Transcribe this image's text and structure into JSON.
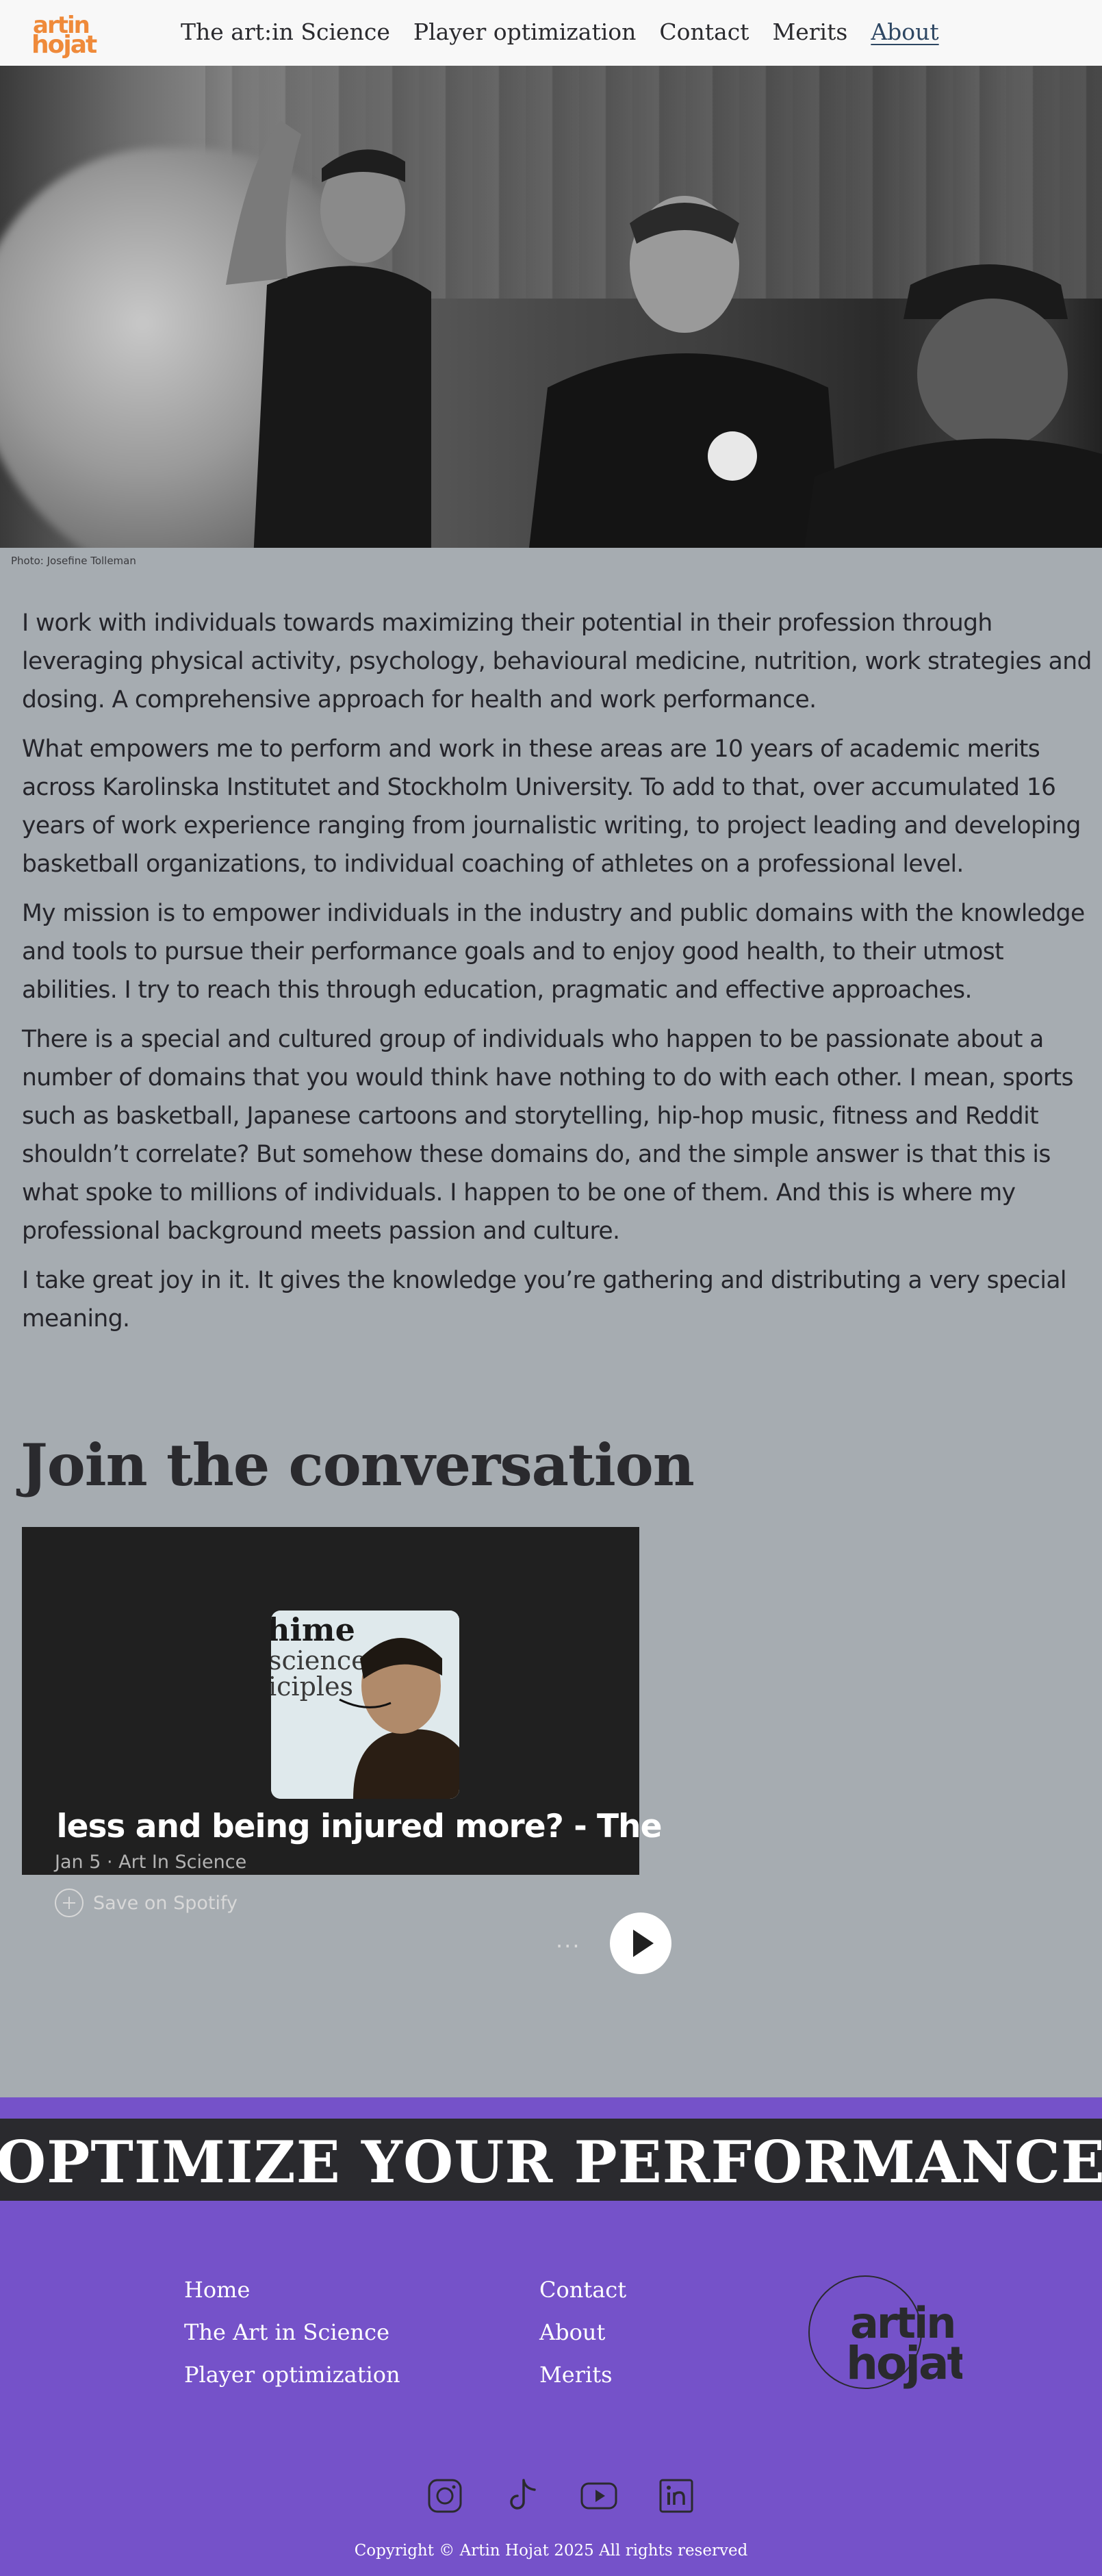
{
  "header": {
    "logo": {
      "line1": "artin",
      "line2": "hojat",
      "color": "#ef8a3a"
    },
    "nav": [
      {
        "label": "The art:in Science"
      },
      {
        "label": "Player optimization"
      },
      {
        "label": "Contact"
      },
      {
        "label": "Merits"
      },
      {
        "label": "About",
        "active": true
      }
    ]
  },
  "hero": {
    "caption": "Photo: Josefine Tolleman"
  },
  "article": {
    "paragraphs": [
      "I work with individuals towards maximizing their potential in their profession through leveraging physical activity, psychology, behavioural medicine, nutrition, work strategies and dosing. A comprehensive approach for health and work performance.",
      "What empowers me to perform and work in these areas are 10 years of academic merits across Karolinska Institutet and Stockholm University. To add to that, over accumulated 16 years of work experience ranging from journalistic writing, to project leading and developing basketball organizations, to individual coaching of athletes on a professional level.",
      "My mission is to empower individuals in the industry and public domains with the knowledge and tools to pursue their performance goals and to enjoy good health, to their utmost abilities. I try to reach this through education, pragmatic and effective approaches.",
      "There is a special and cultured group of individuals who happen to be passionate about a number of domains that you would think have nothing to do with each other. I mean, sports such as basketball, Japanese cartoons and storytelling, hip-hop music, fitness and Reddit shouldn’t correlate? But somehow these domains do, and the simple answer is that this is what spoke to millions of individuals. I happen to be one of them. And this is where my professional background meets passion and culture.",
      "I take great joy in it. It gives the knowledge you’re gathering and distributing a very special meaning."
    ]
  },
  "join": {
    "heading": "Join the conversation"
  },
  "podcast": {
    "episode_title": "ng less and being injured more? - The Bigg",
    "meta": "Jan 5 · Art In Science",
    "save_label": "Save on Spotify",
    "more_label": "···",
    "cover_text": "hime science iciples in"
  },
  "footer": {
    "marquee": "OPTIMIZE YOUR PERFORMANCE OPTIMIZE YOUR PERFORMANCE",
    "links_col1": [
      {
        "label": "Home"
      },
      {
        "label": "The Art in Science"
      },
      {
        "label": "Player optimization"
      }
    ],
    "links_col2": [
      {
        "label": "Contact"
      },
      {
        "label": "About"
      },
      {
        "label": "Merits"
      }
    ],
    "logo": {
      "line1": "artin",
      "line2": "hojat"
    },
    "social": [
      {
        "icon": "instagram-icon"
      },
      {
        "icon": "tiktok-icon"
      },
      {
        "icon": "youtube-icon"
      },
      {
        "icon": "linkedin-icon"
      }
    ],
    "copyright": "Copyright © Artin Hojat 2025 All rights reserved",
    "colors": {
      "background": "#7552c9",
      "band": "#2a2a2e"
    }
  }
}
